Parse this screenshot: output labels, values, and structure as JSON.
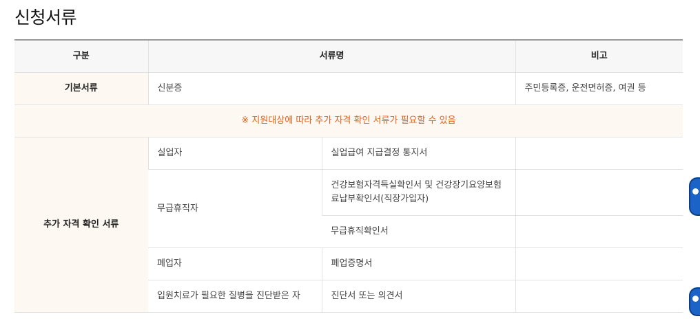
{
  "page": {
    "title": "신청서류"
  },
  "table": {
    "headers": {
      "category": "구분",
      "document_name": "서류명",
      "remarks": "비고"
    },
    "basic": {
      "category": "기본서류",
      "document": "신분증",
      "remark": "주민등록증, 운전면허증, 여권 등"
    },
    "notice": "※ 지원대상에 따라 추가 자격 확인 서류가 필요할 수 있음",
    "additional": {
      "category": "추가 자격 확인 서류",
      "rows": [
        {
          "target": "실업자",
          "document": "실업급여 지급결정 통지서"
        },
        {
          "target": "무급휴직자",
          "document": "건강보험자격득실확인서 및 건강장기요양보험료납부확인서(직장가입자)"
        },
        {
          "target": "",
          "document": "무급휴직확인서"
        },
        {
          "target": "폐업자",
          "document": "폐업증명서"
        },
        {
          "target": "입원치료가 필요한 질병을 진단받은 자",
          "document": "진단서 또는 의견서"
        }
      ]
    }
  },
  "decorations": {
    "mascot_icon": "mascot-character-icon",
    "accent_color": "#e0641e",
    "header_bg": "#f7f7f7",
    "category_bg": "#fdf8f1"
  }
}
